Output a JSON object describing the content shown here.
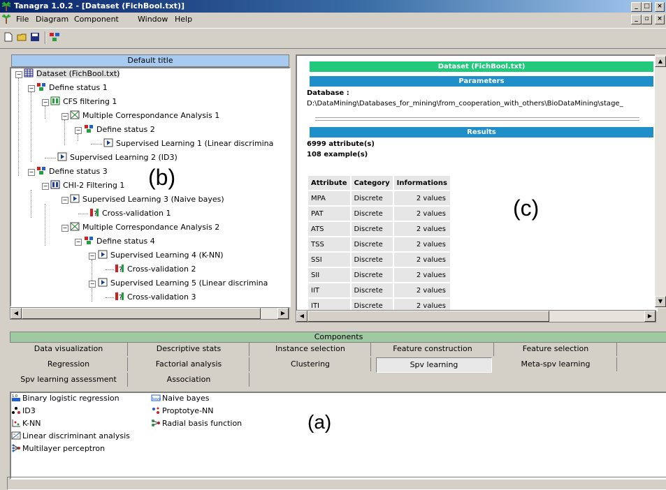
{
  "window": {
    "title": "Tanagra 1.0.2 - [Dataset (FichBool.txt)]",
    "menu": [
      "File",
      "Diagram",
      "Component",
      "Window",
      "Help"
    ],
    "toolbar_icons": [
      "new-file-icon",
      "open-folder-icon",
      "save-disk-icon",
      "component-icon"
    ]
  },
  "tree": {
    "header": "Default title",
    "label": "(b)",
    "nodes": [
      {
        "label": "Dataset (FichBool.txt)",
        "icon": "dataset-table-icon"
      },
      {
        "label": "Define status 1",
        "icon": "define-status-icon"
      },
      {
        "label": "CFS filtering 1",
        "icon": "feature-selection-icon"
      },
      {
        "label": "Multiple Correspondance Analysis 1",
        "icon": "factorial-analysis-icon"
      },
      {
        "label": "Define status 2",
        "icon": "define-status-icon"
      },
      {
        "label": "Supervised Learning 1 (Linear discrimina",
        "icon": "supervised-learning-icon"
      },
      {
        "label": "Supervised Learning 2 (ID3)",
        "icon": "supervised-learning-icon"
      },
      {
        "label": "Define status 3",
        "icon": "define-status-icon"
      },
      {
        "label": "CHI-2 Filtering 1",
        "icon": "feature-selection-icon"
      },
      {
        "label": "Supervised Learning 3 (Naive bayes)",
        "icon": "supervised-learning-icon"
      },
      {
        "label": "Cross-validation 1",
        "icon": "cross-validation-icon"
      },
      {
        "label": "Multiple Correspondance Analysis 2",
        "icon": "factorial-analysis-icon"
      },
      {
        "label": "Define status 4",
        "icon": "define-status-icon"
      },
      {
        "label": "Supervised Learning 4 (K-NN)",
        "icon": "supervised-learning-icon"
      },
      {
        "label": "Cross-validation 2",
        "icon": "cross-validation-icon"
      },
      {
        "label": "Supervised Learning 5 (Linear discrimina",
        "icon": "supervised-learning-icon"
      },
      {
        "label": "Cross-validation 3",
        "icon": "cross-validation-icon"
      }
    ]
  },
  "report": {
    "label": "(c)",
    "dataset_title": "Dataset (FichBool.txt)",
    "parameters_title": "Parameters",
    "database_label": "Database :",
    "database_path": "D:\\DataMining\\Databases_for_mining\\from_cooperation_with_others\\BioDataMining\\stage_",
    "results_title": "Results",
    "attributes_count": "6999 attribute(s)",
    "examples_count": "108 example(s)",
    "table_headers": [
      "Attribute",
      "Category",
      "Informations"
    ],
    "rows": [
      [
        "MPA",
        "Discrete",
        "2 values"
      ],
      [
        "PAT",
        "Discrete",
        "2 values"
      ],
      [
        "ATS",
        "Discrete",
        "2 values"
      ],
      [
        "TSS",
        "Discrete",
        "2 values"
      ],
      [
        "SSI",
        "Discrete",
        "2 values"
      ],
      [
        "SII",
        "Discrete",
        "2 values"
      ],
      [
        "IIT",
        "Discrete",
        "2 values"
      ],
      [
        "ITI",
        "Discrete",
        "2 values"
      ]
    ],
    "colors": {
      "green": "#22c97a",
      "blue": "#1e8fc8"
    }
  },
  "components": {
    "header": "Components",
    "label": "(a)",
    "tabs_row1": [
      "Data visualization",
      "Descriptive stats",
      "Instance selection",
      "Feature construction",
      "Feature selection"
    ],
    "tabs_row2": [
      "Regression",
      "Factorial analysis",
      "Clustering",
      "Spv learning",
      "Meta-spv learning"
    ],
    "tabs_row3": [
      "Spv learning assessment",
      "Association"
    ],
    "active_tab": "Spv learning",
    "items": [
      {
        "label": "Binary logistic regression",
        "icon": "logistic-regression-icon"
      },
      {
        "label": "Naive bayes",
        "icon": "naive-bayes-icon"
      },
      {
        "label": "ID3",
        "icon": "decision-tree-icon"
      },
      {
        "label": "Proptotye-NN",
        "icon": "prototype-nn-icon"
      },
      {
        "label": "K-NN",
        "icon": "knn-icon"
      },
      {
        "label": "Radial basis function",
        "icon": "rbf-network-icon"
      },
      {
        "label": "Linear discriminant analysis",
        "icon": "lda-icon"
      },
      {
        "label": "Multilayer perceptron",
        "icon": "mlp-icon"
      }
    ]
  }
}
